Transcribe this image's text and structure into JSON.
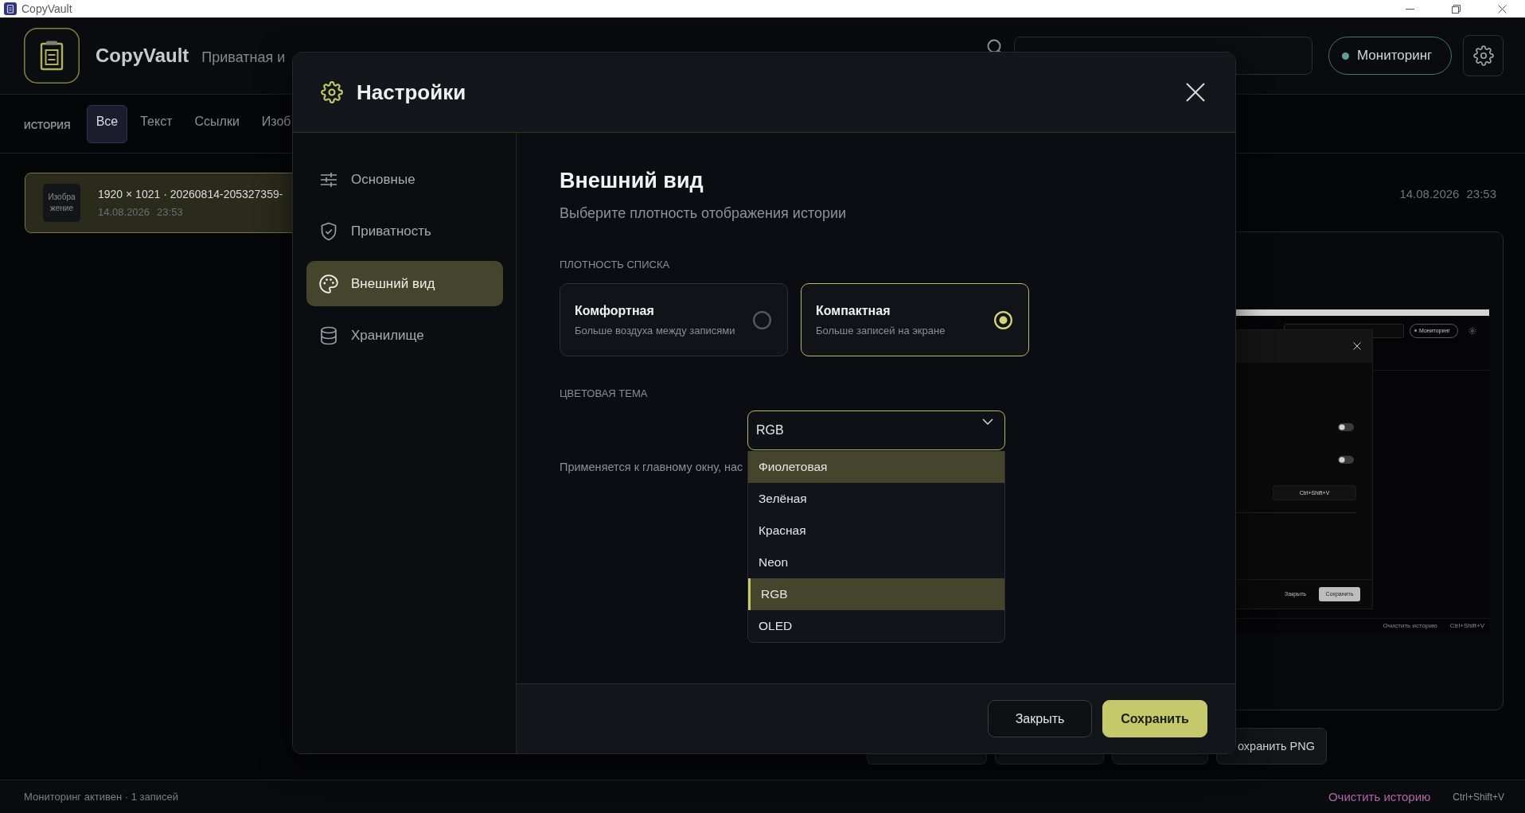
{
  "window": {
    "title": "CopyVault"
  },
  "header": {
    "app_name": "CopyVault",
    "tagline": "Приватная и",
    "monitoring": {
      "label": "Мониторинг",
      "on": true
    }
  },
  "history": {
    "label": "ИСТОРИЯ",
    "tabs": [
      {
        "label": "Все",
        "selected": true
      },
      {
        "label": "Текст",
        "selected": false
      },
      {
        "label": "Ссылки",
        "selected": false
      },
      {
        "label": "Изоб",
        "selected": false
      }
    ],
    "entries": [
      {
        "thumbnail": "Изображение",
        "title": "1920 × 1021 · 20260814-205327359-",
        "date": "14.08.2026",
        "time": "23:53",
        "selected": true
      }
    ]
  },
  "detail": {
    "date": "14.08.2026",
    "time": "23:53",
    "preview": {
      "monitoring": "Мониторинг",
      "toggles": [
        {
          "on": false
        },
        {
          "on": false
        }
      ],
      "shortcut": "Ctrl+Shift+V",
      "close": "Закрыть",
      "save": "Сохранить",
      "status_link": "Очистить историю",
      "status_shortcut": "Ctrl+Shift+V"
    },
    "actions": [
      {
        "kind": "blank"
      },
      {
        "kind": "blank"
      },
      {
        "kind": "blank"
      },
      {
        "kind": "labeled",
        "label": "охранить PNG"
      }
    ]
  },
  "status_bar": {
    "text": "Мониторинг активен · 1 записей",
    "clear_link": "Очистить историю",
    "shortcut": "Ctrl+Shift+V"
  },
  "settings": {
    "title": "Настройки",
    "nav": [
      {
        "label": "Основные",
        "selected": false
      },
      {
        "label": "Приватность",
        "selected": false
      },
      {
        "label": "Внешний вид",
        "selected": true
      },
      {
        "label": "Хранилище",
        "selected": false
      }
    ],
    "section": {
      "title": "Внешний вид",
      "subtitle": "Выберите плотность отображения истории",
      "density_label": "ПЛОТНОСТЬ СПИСКА",
      "density_options": [
        {
          "title": "Комфортная",
          "description": "Больше воздуха между записями",
          "selected": false
        },
        {
          "title": "Компактная",
          "description": "Больше записей на экране",
          "selected": true
        }
      ],
      "theme_label": "ЦВЕТОВАЯ ТЕМА",
      "theme_select": {
        "value": "RGB",
        "expanded": true,
        "options": [
          {
            "label": "Фиолетовая",
            "highlighted": true,
            "selected": false
          },
          {
            "label": "Зелёная",
            "highlighted": false,
            "selected": false
          },
          {
            "label": "Красная",
            "highlighted": false,
            "selected": false
          },
          {
            "label": "Neon",
            "highlighted": false,
            "selected": false
          },
          {
            "label": "RGB",
            "highlighted": false,
            "selected": true
          },
          {
            "label": "OLED",
            "highlighted": false,
            "selected": false
          }
        ]
      },
      "hint": "Применяется к главному окну, нас"
    },
    "buttons": [
      {
        "label": "Закрыть",
        "kind": "secondary"
      },
      {
        "label": "Сохранить",
        "kind": "primary"
      }
    ]
  }
}
